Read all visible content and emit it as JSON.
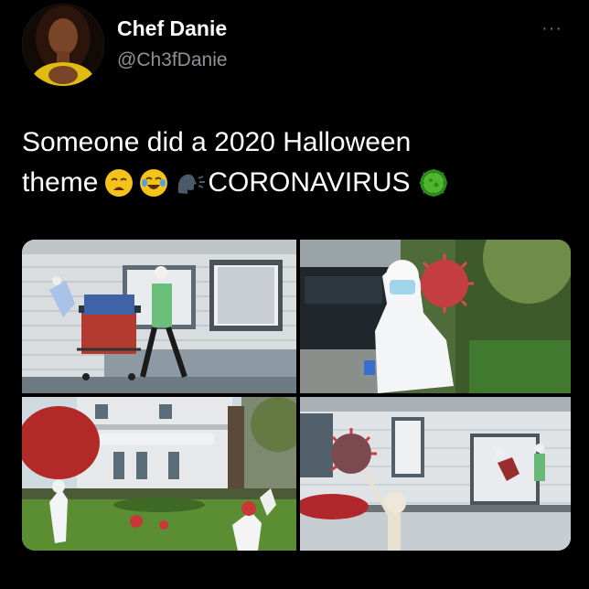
{
  "author": {
    "display_name": "Chef Danie",
    "handle": "@Ch3fDanie"
  },
  "menu": {
    "more_label": "···"
  },
  "tweet": {
    "line1": "Someone did a 2020 Halloween",
    "line2_start": "theme",
    "line2_end": "CORONAVIRUS",
    "emojis": [
      "weary-face-icon",
      "face-with-tears-of-joy-icon",
      "speaking-head-icon",
      "microbe-icon"
    ]
  },
  "colors": {
    "background": "#000000",
    "text": "#ffffff",
    "secondary_text": "#8e9196"
  },
  "photos": [
    "photo-skeleton-shopping-cart-toilet-paper",
    "photo-skeleton-hazmat-suit-with-virus-model",
    "photo-house-lawn-skeletons-and-virus-balls",
    "photo-skeleton-holding-virus-ball-on-porch"
  ]
}
